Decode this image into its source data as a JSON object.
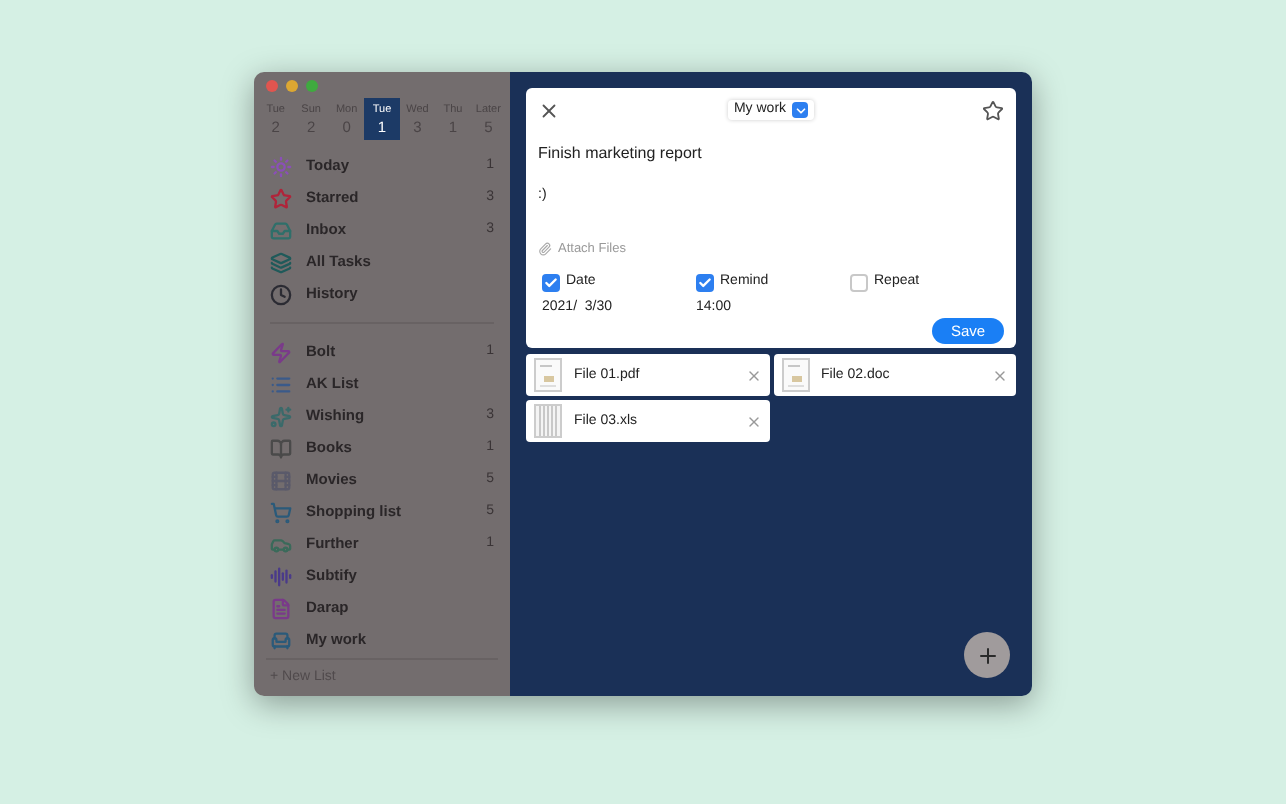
{
  "days": [
    {
      "label": "Tue",
      "count": "2",
      "selected": false
    },
    {
      "label": "Sun",
      "count": "2",
      "selected": false
    },
    {
      "label": "Mon",
      "count": "0",
      "selected": false
    },
    {
      "label": "Tue",
      "count": "1",
      "selected": true
    },
    {
      "label": "Wed",
      "count": "3",
      "selected": false
    },
    {
      "label": "Thu",
      "count": "1",
      "selected": false
    },
    {
      "label": "Later",
      "count": "5",
      "selected": false
    }
  ],
  "smart_lists": [
    {
      "kind": "today",
      "label": "Today",
      "count": "1"
    },
    {
      "kind": "starred",
      "label": "Starred",
      "count": "3"
    },
    {
      "kind": "inbox",
      "label": "Inbox",
      "count": "3"
    },
    {
      "kind": "all",
      "label": "All Tasks"
    },
    {
      "kind": "history",
      "label": "History"
    }
  ],
  "lists": [
    {
      "kind": "bolt",
      "label": "Bolt",
      "count": "1"
    },
    {
      "kind": "list",
      "label": "AK List"
    },
    {
      "kind": "sparkle",
      "label": "Wishing",
      "count": "3"
    },
    {
      "kind": "book",
      "label": "Books",
      "count": "1"
    },
    {
      "kind": "film",
      "label": "Movies",
      "count": "5"
    },
    {
      "kind": "cart",
      "label": "Shopping list",
      "count": "5"
    },
    {
      "kind": "car",
      "label": "Further",
      "count": "1"
    },
    {
      "kind": "audio",
      "label": "Subtify"
    },
    {
      "kind": "file",
      "label": "Darap"
    },
    {
      "kind": "chair",
      "label": "My work"
    }
  ],
  "new_list": "+ New List",
  "task": {
    "list": "My work",
    "starred": false,
    "title": "Finish marketing report",
    "note": ":)",
    "attach": "Attach Files",
    "options": [
      {
        "label": "Date",
        "checked": true,
        "value": "2021/  3/30"
      },
      {
        "label": "Remind",
        "checked": true,
        "value": "14:00"
      },
      {
        "label": "Repeat",
        "checked": false
      }
    ],
    "save": "Save"
  },
  "files": [
    {
      "kind": "doc",
      "name": "File 01.pdf"
    },
    {
      "kind": "doc",
      "name": "File 02.doc"
    },
    {
      "kind": "sheet",
      "name": "File 03.xls"
    }
  ]
}
